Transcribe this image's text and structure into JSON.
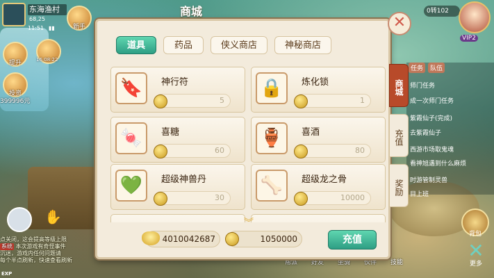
{
  "hud": {
    "location": "东海渔村",
    "coords": "68,25",
    "clock": "11:51",
    "xinshou": "新手",
    "tisheng": "提升",
    "fuli_time": "16:08:22",
    "touzi": "投资",
    "gold_amount": "399996元",
    "vitality": "0转102",
    "vip": "VIP2",
    "exp": "EXP",
    "chat": {
      "line1": "点关闭，这会提高等级上限",
      "tag": "系统",
      "line2": "本次游戏有奇怪事件",
      "line3": "沉迷，游戏内任何问题请",
      "line4": "每个半点刷新，快速查看刷新"
    },
    "tasks": {
      "tab1": "任务",
      "tab2": "队伍",
      "lines": [
        "师门任务",
        "成一次师门任务",
        "紫霞仙子(完成)",
        "去紫霞仙子",
        "西游市场取鬼魂",
        "看神旭遇到什么麻烦",
        "时游管制灵兽",
        "目上班"
      ]
    },
    "bottom": [
      "帮派",
      "好友",
      "坐骑",
      "伙伴",
      "技能"
    ],
    "bag": "背包",
    "more": "更多"
  },
  "shop": {
    "title": "商城",
    "tabs": [
      "道具",
      "药品",
      "侠义商店",
      "神秘商店"
    ],
    "active_tab": 0,
    "side_tabs": [
      "商城",
      "充值",
      "奖励"
    ],
    "items": [
      {
        "name": "神行符",
        "price": "5",
        "icon": "talisman-icon",
        "glyph": "🔖"
      },
      {
        "name": "炼化锁",
        "price": "1",
        "icon": "lock-icon",
        "glyph": "🔒"
      },
      {
        "name": "喜糖",
        "price": "60",
        "icon": "candy-icon",
        "glyph": "🍬"
      },
      {
        "name": "喜酒",
        "price": "80",
        "icon": "wine-jar-icon",
        "glyph": "🏺"
      },
      {
        "name": "超级神兽丹",
        "price": "30",
        "icon": "jade-pill-icon",
        "glyph": "💚"
      },
      {
        "name": "超级龙之骨",
        "price": "10000",
        "icon": "dragon-bone-icon",
        "glyph": "🦴"
      }
    ],
    "silver": "4010042687",
    "coins": "1050000",
    "recharge": "充值"
  }
}
